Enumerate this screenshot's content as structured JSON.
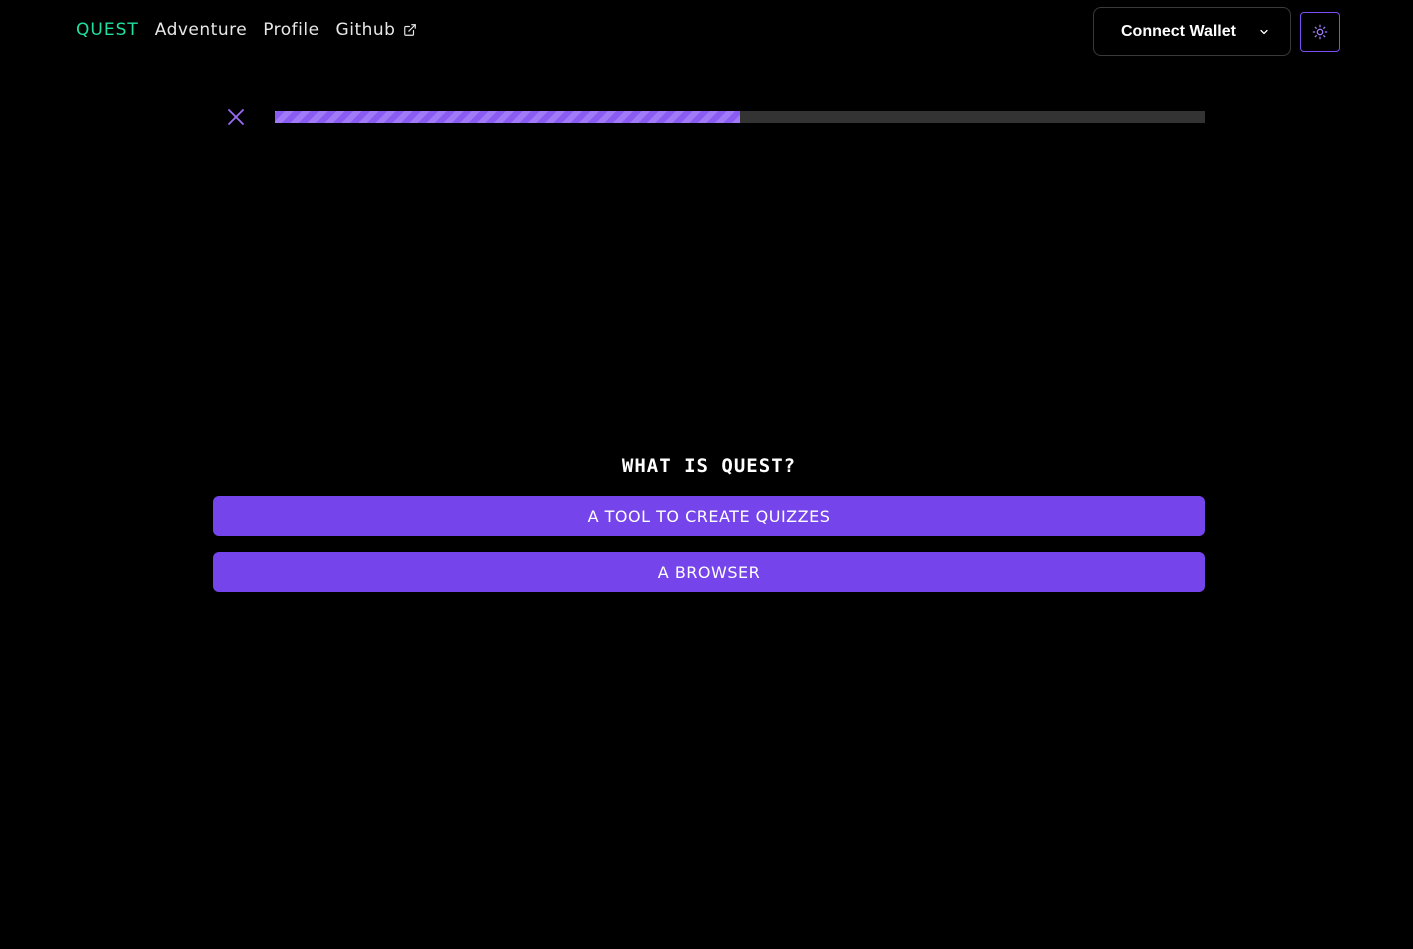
{
  "nav": {
    "brand": "QUEST",
    "links": [
      {
        "label": "Adventure"
      },
      {
        "label": "Profile"
      },
      {
        "label": "Github",
        "icon": "external-link-icon"
      }
    ]
  },
  "wallet": {
    "label": "Connect Wallet",
    "icon": "chevron-down-icon"
  },
  "theme_toggle": {
    "icon": "sun-icon"
  },
  "quiz": {
    "close_icon": "close-icon",
    "progress": 0.5,
    "question": "WHAT IS QUEST?",
    "answers": [
      {
        "label": "A TOOL TO CREATE QUIZZES"
      },
      {
        "label": "A BROWSER"
      }
    ]
  },
  "colors": {
    "background": "#000000",
    "brand": "#1fe0a0",
    "accent": "#7544ea",
    "progress_track": "#333333",
    "progress_fill": "#a07af7"
  }
}
